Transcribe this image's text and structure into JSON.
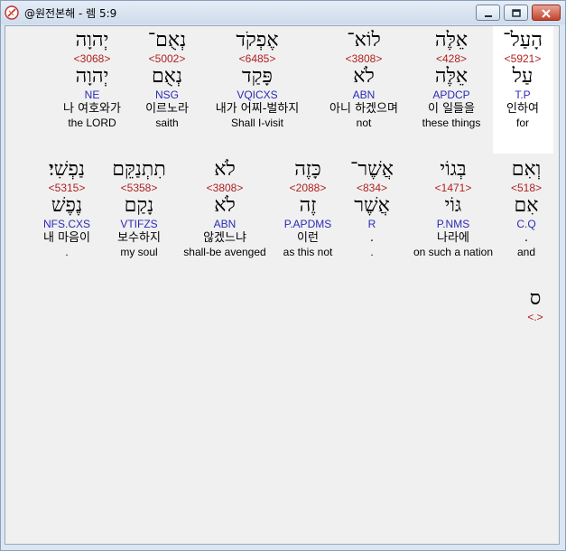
{
  "window": {
    "title": "@원전본해 - 렘 5:9",
    "minimize_icon": "minimize-icon",
    "maximize_icon": "maximize-icon",
    "close_icon": "close-icon"
  },
  "row1": [
    {
      "heb": "הָעַל־",
      "num": "<5921>",
      "heb2": "עַל",
      "morph": "T.P",
      "kor": "인하여",
      "eng": "for",
      "highlight": true
    },
    {
      "heb": "אֵלֶּה",
      "num": "<428>",
      "heb2": "אֵלֶּה",
      "morph": "APDCP",
      "kor": "이 일들을",
      "eng": "these things"
    },
    {
      "heb": "לוֹא־",
      "num": "<3808>",
      "heb2": "לֹא",
      "morph": "ABN",
      "kor": "아니 하겠으며",
      "eng": "not"
    },
    {
      "heb": "אֶפְקֹד",
      "num": "<6485>",
      "heb2": "פָּקַד",
      "morph": "VQICXS",
      "kor": "내가 어찌-벌하지",
      "eng": "Shall I-visit"
    },
    {
      "heb": "נְאֻם־",
      "num": "<5002>",
      "heb2": "נְאֻם",
      "morph": "NSG",
      "kor": "이르노라",
      "eng": "saith"
    },
    {
      "heb": "יְהוָה",
      "num": "<3068>",
      "heb2": "יְהוָה",
      "morph": "NE",
      "kor": "나 여호와가",
      "eng": "the LORD"
    }
  ],
  "row2": [
    {
      "heb": "וְאִם",
      "num": "<518>",
      "heb2": "אִם",
      "morph": "C.Q",
      "kor": ".",
      "eng": "and"
    },
    {
      "heb": "בְּגוֹי",
      "num": "<1471>",
      "heb2": "גּוֹי",
      "morph": "P.NMS",
      "kor": "나라에",
      "eng": "on such a nation"
    },
    {
      "heb": "אֲשֶׁר־",
      "num": "<834>",
      "heb2": "אֲשֶׁר",
      "morph": "R",
      "kor": ".",
      "eng": "."
    },
    {
      "heb": "כָּזֶה",
      "num": "<2088>",
      "heb2": "זֶה",
      "morph": "P.APDMS",
      "kor": "이런",
      "eng": "as this not"
    },
    {
      "heb": "לֹא",
      "num": "<3808>",
      "heb2": "לֹא",
      "morph": "ABN",
      "kor": "않겠느냐",
      "eng": "shall-be avenged"
    },
    {
      "heb": "תִתְנַקֵּם",
      "num": "<5358>",
      "heb2": "נָקַם",
      "morph": "VTIFZS",
      "kor": "보수하지",
      "eng": "my soul"
    },
    {
      "heb": "נַפְשִׁי׃",
      "num": "<5315>",
      "heb2": "נֶפֶשׁ",
      "morph": "NFS.CXS",
      "kor": "내 마음이",
      "eng": "."
    }
  ],
  "row3": [
    {
      "heb": "ס",
      "num": "<.>"
    }
  ]
}
